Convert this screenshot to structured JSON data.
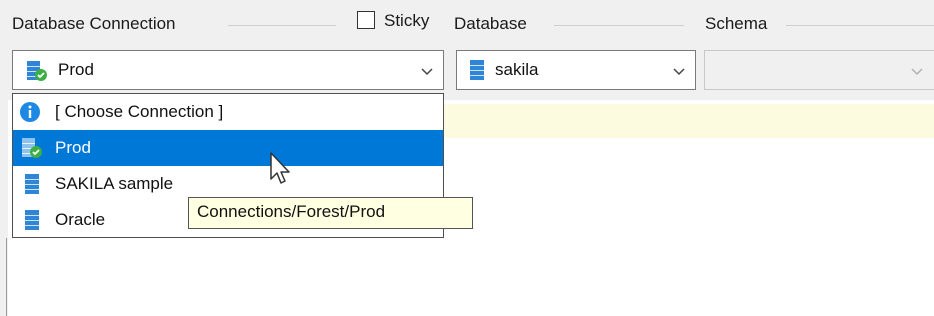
{
  "connection_group": {
    "label": "Database Connection",
    "selected": "Prod",
    "selected_icon": "database-connected-icon"
  },
  "sticky": {
    "label": "Sticky",
    "checked": false
  },
  "database_group": {
    "label": "Database",
    "selected": "sakila",
    "selected_icon": "database-icon"
  },
  "schema_group": {
    "label": "Schema",
    "selected": ""
  },
  "dropdown": {
    "items": [
      {
        "label": "[ Choose Connection ]",
        "icon": "info-icon",
        "selected": false
      },
      {
        "label": "Prod",
        "icon": "database-connected-icon",
        "selected": true
      },
      {
        "label": "SAKILA sample",
        "icon": "database-icon",
        "selected": false
      },
      {
        "label": "Oracle",
        "icon": "database-icon",
        "selected": false
      }
    ]
  },
  "tooltip": {
    "text": "Connections/Forest/Prod"
  },
  "colors": {
    "selection": "#0078d7",
    "tooltip_bg": "#ffffe1",
    "info_blue": "#1e88e5",
    "db_blue": "#2f86d6",
    "connected_green": "#3cb043"
  }
}
